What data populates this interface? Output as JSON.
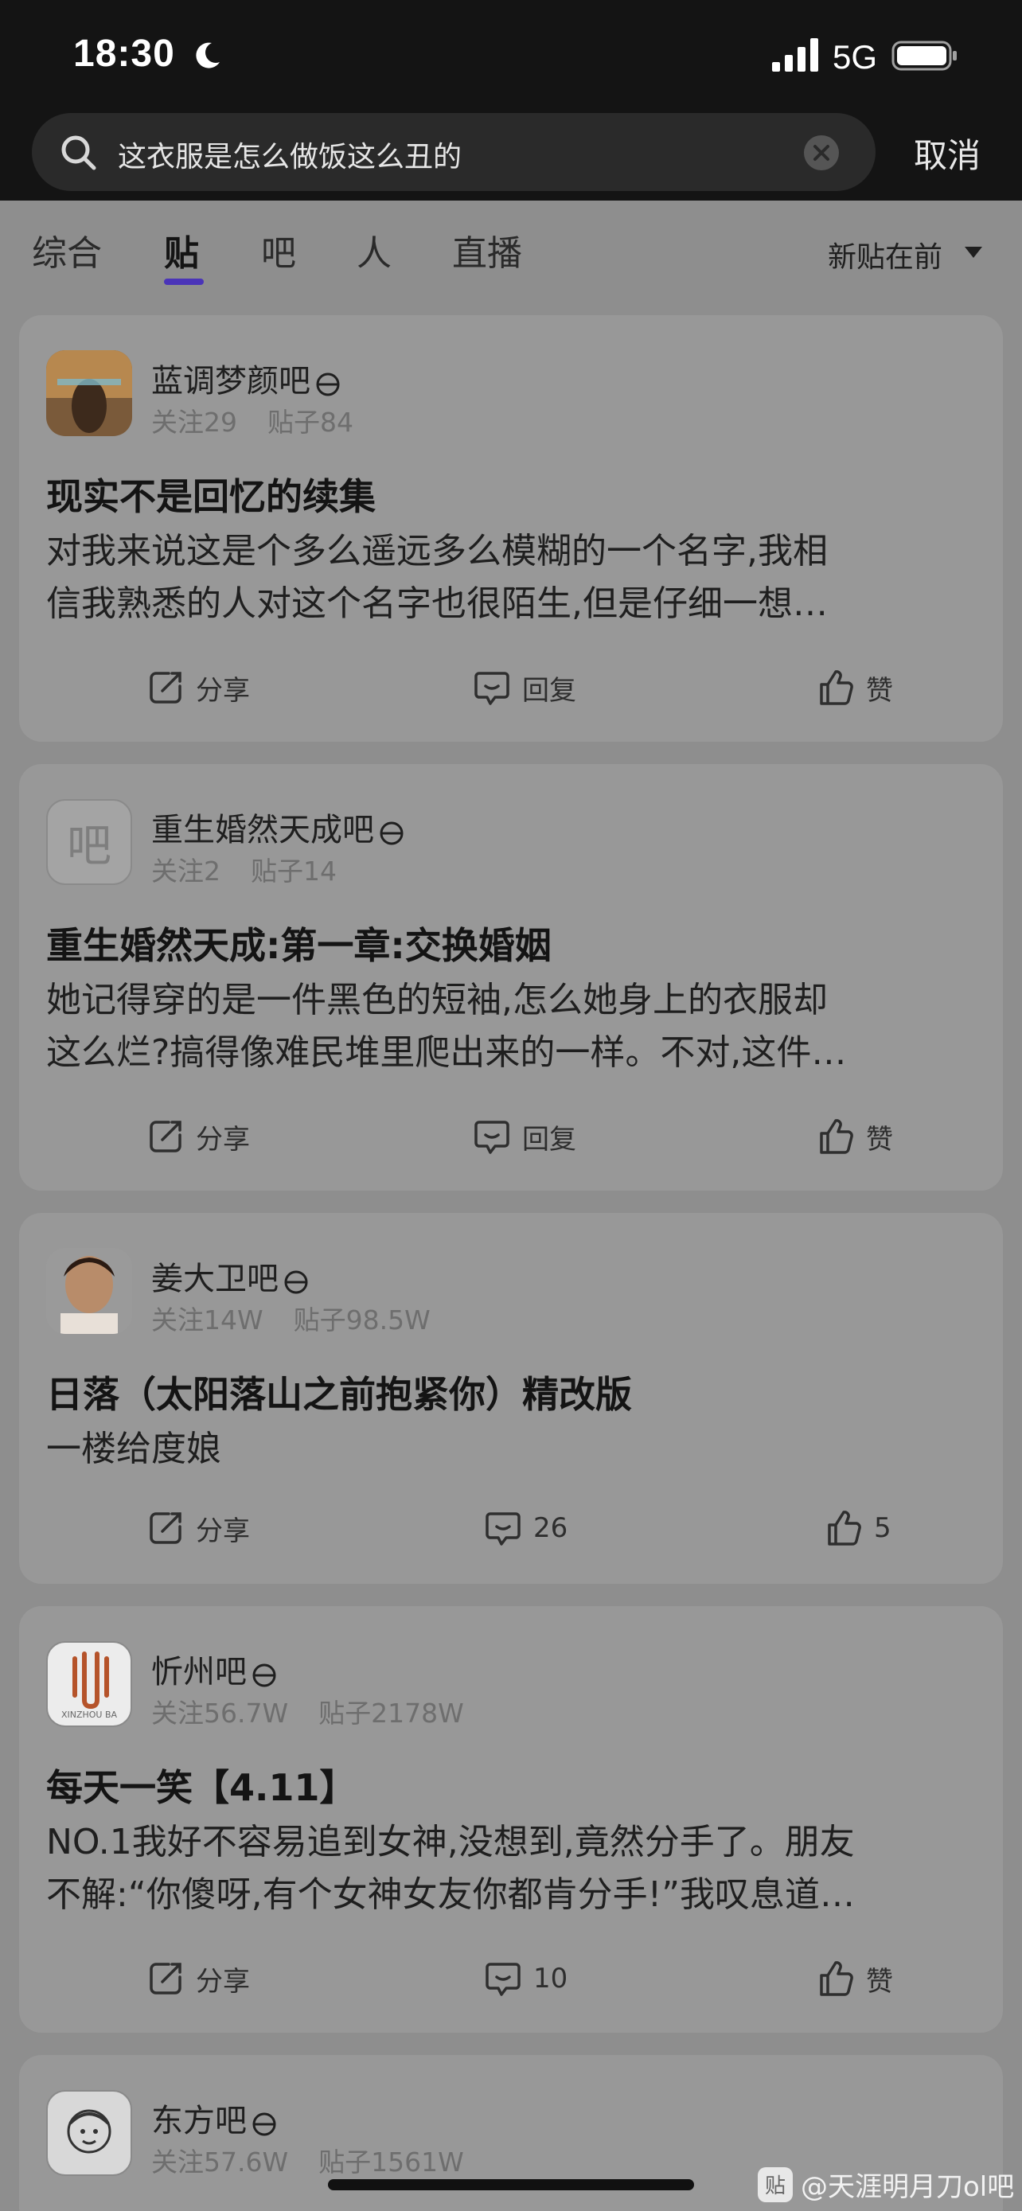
{
  "status_bar": {
    "time": "18:30",
    "network": "5G"
  },
  "search": {
    "query": "这衣服是怎么做饭这么丑的",
    "cancel_label": "取消"
  },
  "tabs": [
    {
      "label": "综合"
    },
    {
      "label": "贴"
    },
    {
      "label": "吧"
    },
    {
      "label": "人"
    },
    {
      "label": "直播"
    }
  ],
  "active_tab": "贴",
  "sort_label": "新贴在前",
  "posts": [
    {
      "forum": "蓝调梦颜吧",
      "followers": "关注29",
      "posts_count": "贴子84",
      "title": "现实不是回忆的续集",
      "body_line1": "对我来说这是个多么遥远多么模糊的一个名字,我相",
      "body_line2": "信我熟悉的人对这个名字也很陌生,但是仔细一想…",
      "share": "分享",
      "reply": "回复",
      "like": "赞"
    },
    {
      "forum": "重生婚然天成吧",
      "avatar_text": "吧",
      "followers": "关注2",
      "posts_count": "贴子14",
      "title": "重生婚然天成:第一章:交换婚姻",
      "body_line1": "她记得穿的是一件黑色的短袖,怎么她身上的衣服却",
      "body_line2": "这么烂?搞得像难民堆里爬出来的一样。不对,这件…",
      "share": "分享",
      "reply": "回复",
      "like": "赞"
    },
    {
      "forum": "姜大卫吧",
      "followers": "关注14W",
      "posts_count": "贴子98.5W",
      "title": "日落（太阳落山之前抱紧你）精改版",
      "body_line1": "一楼给度娘",
      "body_line2": "",
      "share": "分享",
      "reply": "26",
      "like": "5"
    },
    {
      "forum": "忻州吧",
      "avatar_caption": "XINZHOU BA",
      "followers": "关注56.7W",
      "posts_count": "贴子2178W",
      "title": "每天一笑【4.11】",
      "body_line1": "NO.1我好不容易追到女神,没想到,竟然分手了。朋友",
      "body_line2": "不解:“你傻呀,有个女神女友你都肯分手!”我叹息道…",
      "share": "分享",
      "reply": "10",
      "like": "赞"
    },
    {
      "forum": "东方吧",
      "followers": "关注57.6W",
      "posts_count": "贴子1561W"
    }
  ],
  "watermark": {
    "badge": "贴",
    "text": "@天涯明月刀ol吧"
  },
  "colors": {
    "tab_indicator": "#4a34b8",
    "overlay_gray": "#8e8e8e",
    "card": "#989898"
  }
}
